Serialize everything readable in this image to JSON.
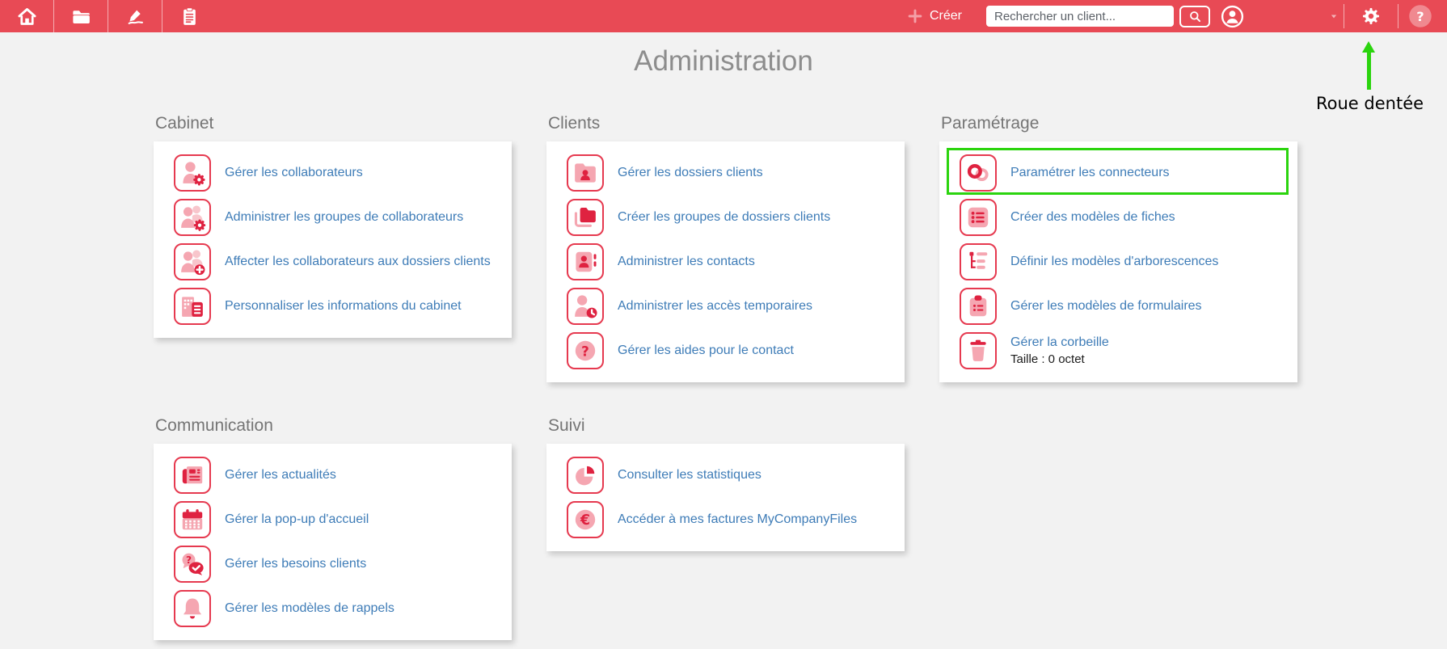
{
  "page": {
    "title": "Administration",
    "background": "#f2f2f2"
  },
  "topbar": {
    "bg_color": "#e84a55",
    "nav_icons": [
      "home-icon",
      "folder-icon",
      "signature-icon",
      "clipboard-icon"
    ],
    "create_label": "Créer",
    "search_placeholder": "Rechercher un client...",
    "right_icons": [
      "chevron-down-icon",
      "gear-icon",
      "help-icon"
    ]
  },
  "annotation": {
    "label": "Roue dentée",
    "color": "#2bd40e",
    "target": "gear-icon"
  },
  "colors": {
    "accent_red": "#e84a55",
    "icon_border_red": "#e6394f",
    "icon_red": "#df2240",
    "icon_pink": "#f5a6b1",
    "link_blue": "#3e7cb7",
    "highlight_green": "#2bd40e",
    "title_gray": "#8d8d8d"
  },
  "sections": [
    {
      "title": "Cabinet",
      "items": [
        {
          "icon": "user-gear-icon",
          "label": "Gérer les collaborateurs"
        },
        {
          "icon": "users-gear-icon",
          "label": "Administrer les groupes de collaborateurs"
        },
        {
          "icon": "users-plus-icon",
          "label": "Affecter les collaborateurs aux dossiers clients"
        },
        {
          "icon": "building-list-icon",
          "label": "Personnaliser les informations du cabinet"
        }
      ]
    },
    {
      "title": "Clients",
      "items": [
        {
          "icon": "folder-user-icon",
          "label": "Gérer les dossiers clients"
        },
        {
          "icon": "folders-icon",
          "label": "Créer les groupes de dossiers clients"
        },
        {
          "icon": "contact-card-icon",
          "label": "Administrer les contacts"
        },
        {
          "icon": "user-clock-icon",
          "label": "Administrer les accès temporaires"
        },
        {
          "icon": "question-circle-icon",
          "label": "Gérer les aides pour le contact"
        }
      ]
    },
    {
      "title": "Paramétrage",
      "items": [
        {
          "icon": "link-icon",
          "label": "Paramétrer les connecteurs",
          "highlighted": true
        },
        {
          "icon": "list-icon",
          "label": "Créer des modèles de fiches"
        },
        {
          "icon": "tree-icon",
          "label": "Définir les modèles d'arborescences"
        },
        {
          "icon": "clipboard-list-icon",
          "label": "Gérer les modèles de formulaires"
        },
        {
          "icon": "trash-icon",
          "label": "Gérer la corbeille",
          "sublabel": "Taille : 0 octet"
        }
      ]
    },
    {
      "title": "Communication",
      "items": [
        {
          "icon": "newspaper-icon",
          "label": "Gérer les actualités"
        },
        {
          "icon": "calendar-icon",
          "label": "Gérer la pop-up d'accueil"
        },
        {
          "icon": "chat-question-icon",
          "label": "Gérer les besoins clients"
        },
        {
          "icon": "bell-icon",
          "label": "Gérer les modèles de rappels"
        }
      ]
    },
    {
      "title": "Suivi",
      "items": [
        {
          "icon": "pie-chart-icon",
          "label": "Consulter les statistiques"
        },
        {
          "icon": "euro-circle-icon",
          "label": "Accéder à mes factures MyCompanyFiles"
        }
      ]
    }
  ]
}
